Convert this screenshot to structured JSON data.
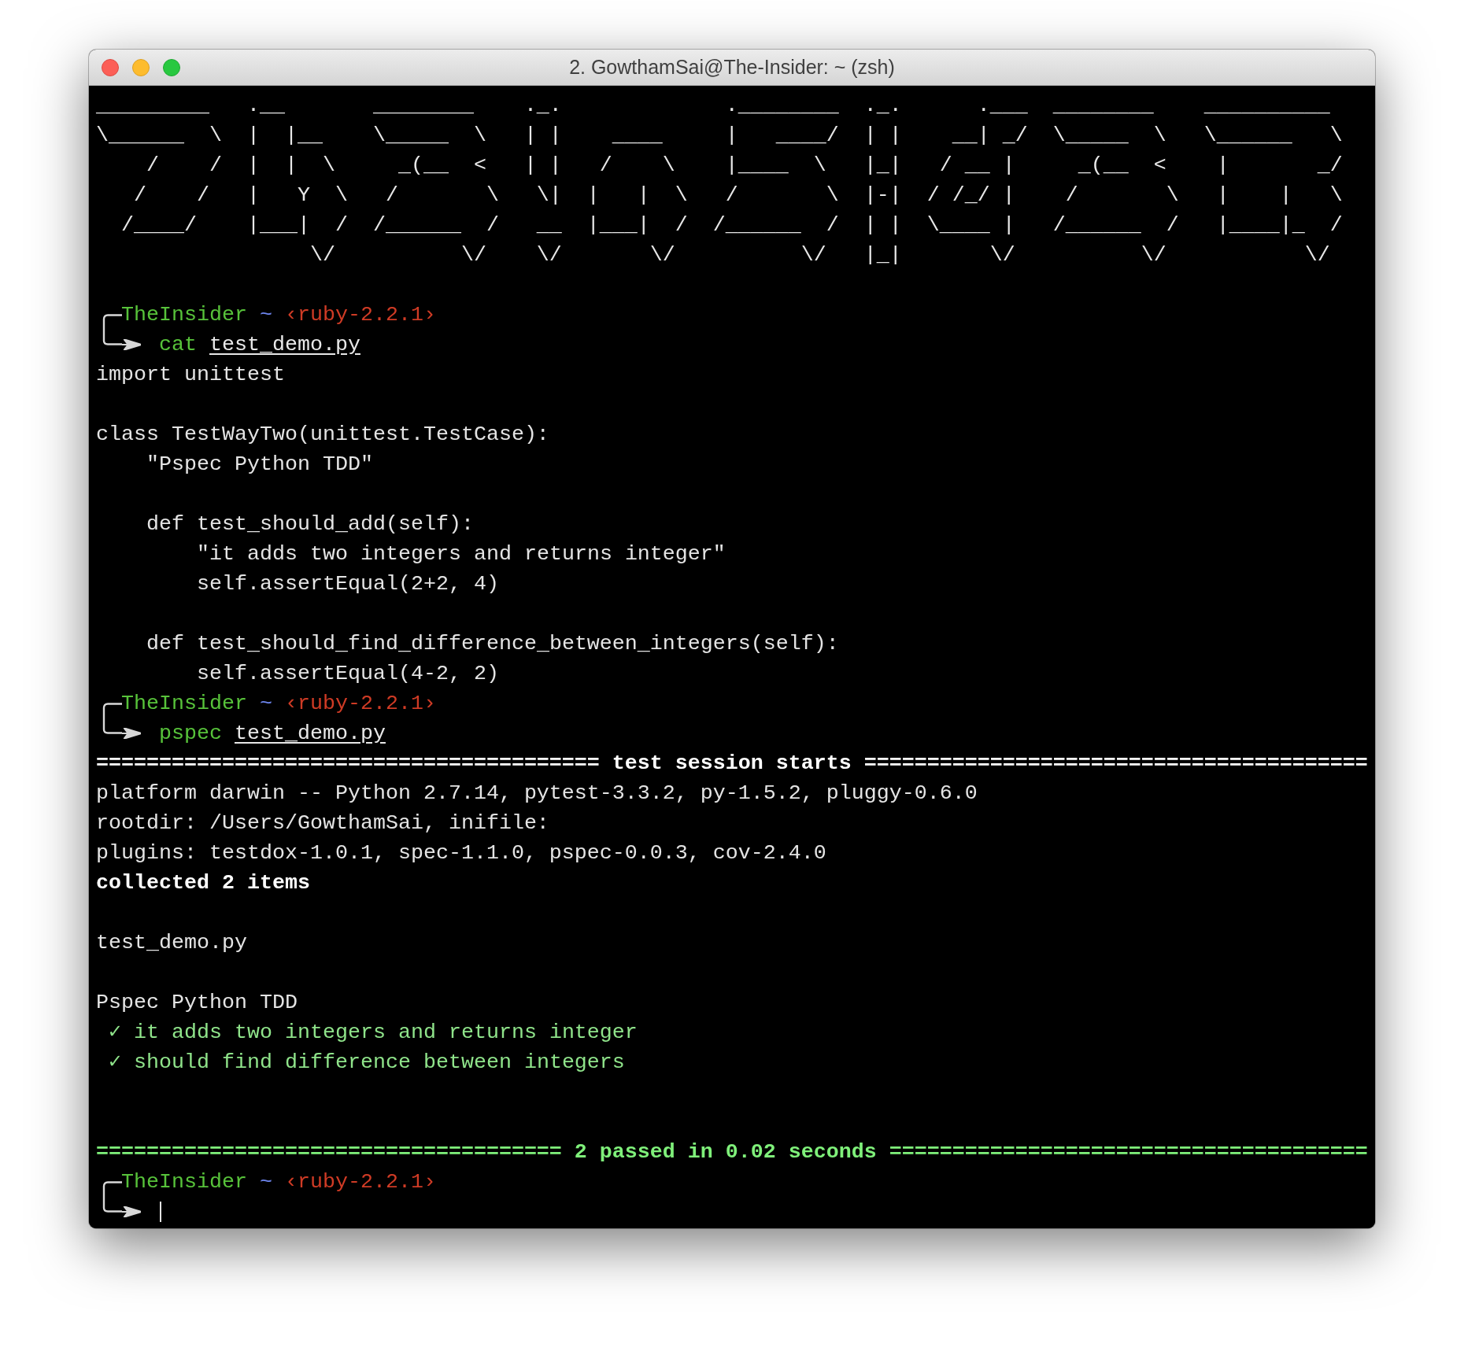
{
  "window": {
    "title": "2. GowthamSai@The-Insider: ~ (zsh)"
  },
  "terminal": {
    "banner": [
      "_________   .__       ________    ._.             .________  ._.      .___  ________    __________",
      "\\______  \\  |  |__    \\_____  \\   | |    ____     |   ____/  | |    __| _/  \\_____  \\   \\______   \\",
      "    /    /  |  |  \\     _(__  <   | |   /    \\    |____  \\   |_|   / __ |     _(__  <    |       _/",
      "   /    /   |   Y  \\   /       \\   \\|  |   |  \\   /       \\  |-|  / /_/ |    /       \\   |    |   \\",
      "  /____/    |___|  /  /______  /   __  |___|  /  /______  /  | |  \\____ |   /______  /   |____|_  /",
      "                 \\/          \\/    \\/       \\/          \\/   |_|       \\/          \\/           \\/"
    ],
    "lines": [
      {
        "kind": "blank"
      },
      {
        "kind": "prompt",
        "user": "TheInsider",
        "path": "~",
        "env": "‹ruby-2.2.1›",
        "command": "cat",
        "argument": "test_demo.py"
      },
      {
        "kind": "code",
        "text": "import unittest"
      },
      {
        "kind": "blank"
      },
      {
        "kind": "code",
        "text": "class TestWayTwo(unittest.TestCase):",
        "children": [
          {
            "kind": "code",
            "text": "\"Pspec Python TDD\""
          },
          {
            "kind": "blank"
          },
          {
            "kind": "code",
            "text": "def test_should_add(self):",
            "children": [
              {
                "kind": "code",
                "text": "\"it adds two integers and returns integer\""
              },
              {
                "kind": "code",
                "text": "self.assertEqual(2+2, 4)"
              }
            ]
          },
          {
            "kind": "blank"
          },
          {
            "kind": "code",
            "text": "def test_should_find_difference_between_integers(self):",
            "children": [
              {
                "kind": "code",
                "text": "self.assertEqual(4-2, 2)"
              }
            ]
          }
        ]
      },
      {
        "kind": "prompt",
        "user": "TheInsider",
        "path": "~",
        "env": "‹ruby-2.2.1›",
        "command": "pspec",
        "argument": "test_demo.py"
      },
      {
        "kind": "heading",
        "text": "======================================== test session starts ========================================"
      },
      {
        "kind": "text",
        "text": "platform darwin -- Python 2.7.14, pytest-3.3.2, py-1.5.2, pluggy-0.6.0"
      },
      {
        "kind": "text",
        "text": "rootdir: /Users/GowthamSai, inifile:"
      },
      {
        "kind": "text",
        "text": "plugins: testdox-1.0.1, spec-1.1.0, pspec-0.0.3, cov-2.4.0"
      },
      {
        "kind": "strong",
        "text": "collected 2 items"
      },
      {
        "kind": "blank"
      },
      {
        "kind": "text",
        "text": "test_demo.py"
      },
      {
        "kind": "blank"
      },
      {
        "kind": "text",
        "text": "Pspec Python TDD"
      },
      {
        "kind": "pass",
        "mark": "✓",
        "text": "it adds two integers and returns integer"
      },
      {
        "kind": "pass",
        "mark": "✓",
        "text": "should find difference between integers"
      },
      {
        "kind": "blank"
      },
      {
        "kind": "blank"
      },
      {
        "kind": "summary",
        "text": "===================================== 2 passed in 0.02 seconds ======================================"
      },
      {
        "kind": "prompt",
        "user": "TheInsider",
        "path": "~",
        "env": "‹ruby-2.2.1›",
        "cursor": true
      }
    ]
  }
}
